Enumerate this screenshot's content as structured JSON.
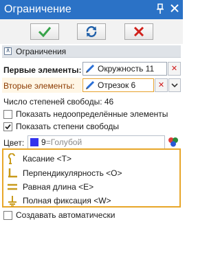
{
  "window": {
    "title": "Ограничение",
    "pin_icon": "pin-icon",
    "close_icon": "close-icon"
  },
  "toolbar": {
    "ok_icon": "checkmark-icon",
    "refresh_icon": "refresh-icon",
    "cancel_icon": "cross-icon",
    "ok_color": "#37a34a",
    "cancel_color": "#d0201a"
  },
  "section": {
    "title": "Ограничения",
    "expanded_symbol": "⊼"
  },
  "first_elements": {
    "label": "Первые элементы:",
    "value": "Окружность 11",
    "remove_symbol": "✕"
  },
  "second_elements": {
    "label": "Вторые элементы:",
    "value": "Отрезок 6",
    "remove_symbol": "✕"
  },
  "dof_count": "Число степеней свободы: 46",
  "checkboxes": {
    "show_underdefined": {
      "label": "Показать недоопределённые элементы",
      "checked": false
    },
    "show_dof": {
      "label": "Показать степени свободы",
      "checked": true
    },
    "create_auto": {
      "label": "Создавать автоматически",
      "checked": false
    }
  },
  "color": {
    "label": "Цвет:",
    "number": "9",
    "name": "=Голубой",
    "swatch": "#3333ee"
  },
  "constraints": [
    {
      "label": "Касание <T>",
      "icon": "tangent-icon"
    },
    {
      "label": "Перпендикулярность <O>",
      "icon": "perpendicular-icon"
    },
    {
      "label": "Равная длина <E>",
      "icon": "equal-length-icon"
    },
    {
      "label": "Полная фиксация <W>",
      "icon": "full-fix-icon"
    }
  ],
  "colors": {
    "title_bar": "#2b72c6",
    "highlight_border": "#e8a628",
    "constraint_icon": "#c89a1a"
  }
}
